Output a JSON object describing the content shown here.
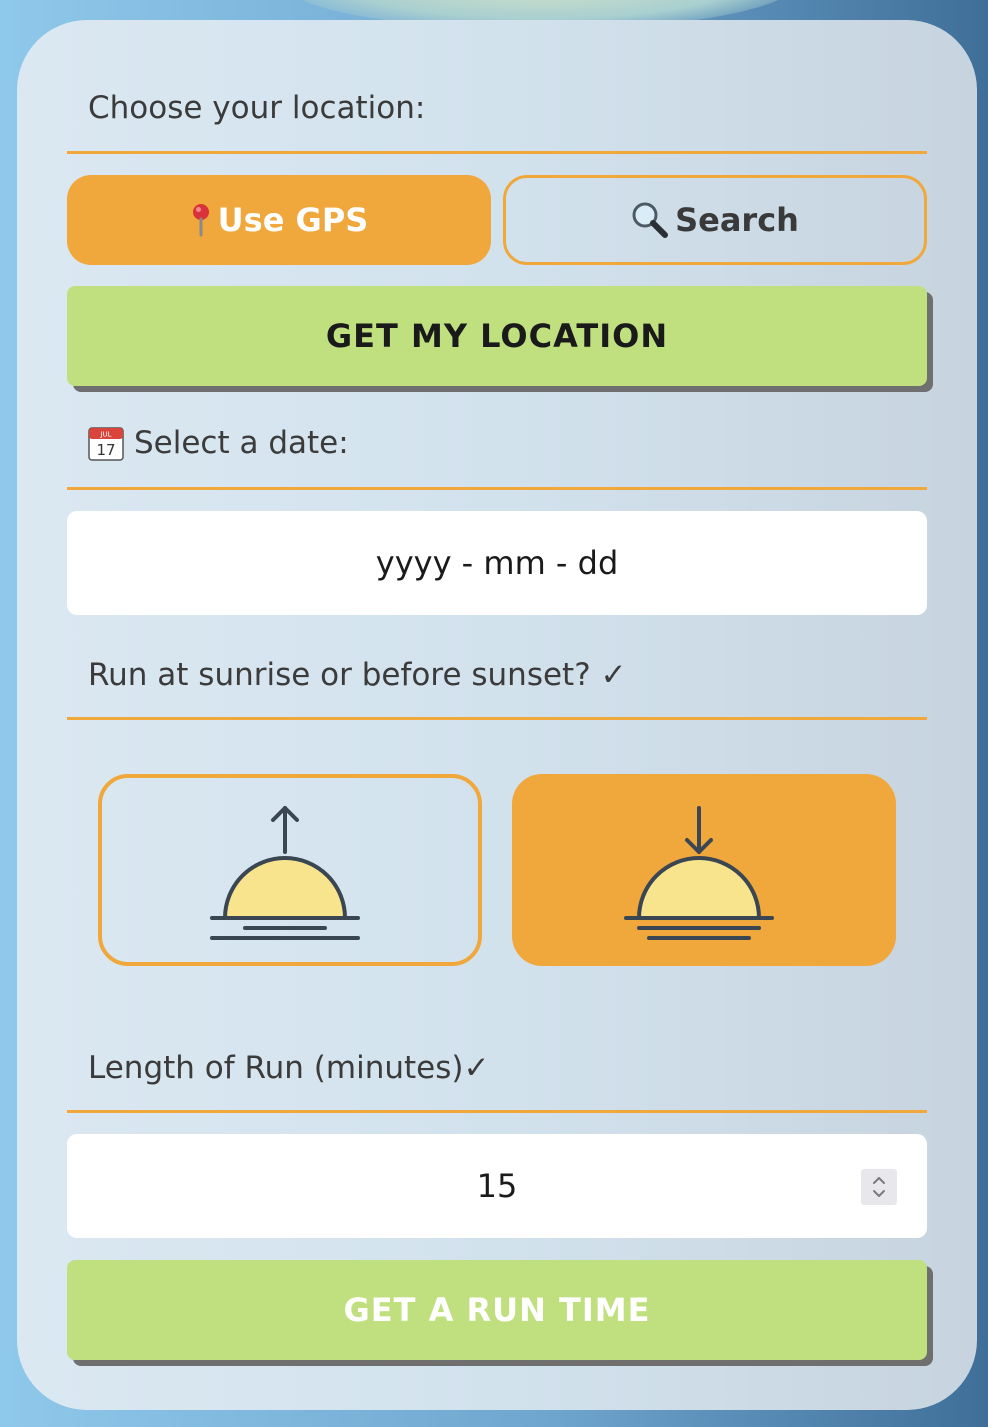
{
  "location": {
    "label": "Choose your location:",
    "gps_label": "Use GPS",
    "gps_icon": "pin-icon",
    "search_label": "Search",
    "search_icon": "magnifier-icon",
    "get_location_button": "GET MY LOCATION"
  },
  "date": {
    "label": "Select a date:",
    "icon": "calendar-icon",
    "calendar_icon_month": "JUL",
    "calendar_icon_day": "17",
    "placeholder": "yyyy - mm - dd"
  },
  "time_of_day": {
    "label": "Run at sunrise or before sunset? ✓",
    "options": [
      {
        "name": "sunrise",
        "icon": "sunrise-icon",
        "selected": false
      },
      {
        "name": "sunset",
        "icon": "sunset-icon",
        "selected": true
      }
    ]
  },
  "length": {
    "label": "Length of Run (minutes)✓",
    "value": "15"
  },
  "submit": {
    "label": "GET A RUN TIME"
  },
  "colors": {
    "accent": "#f0a73b",
    "button_green": "#c0e07f",
    "sun_fill": "#f9e48e",
    "icon_stroke": "#3a4652"
  }
}
